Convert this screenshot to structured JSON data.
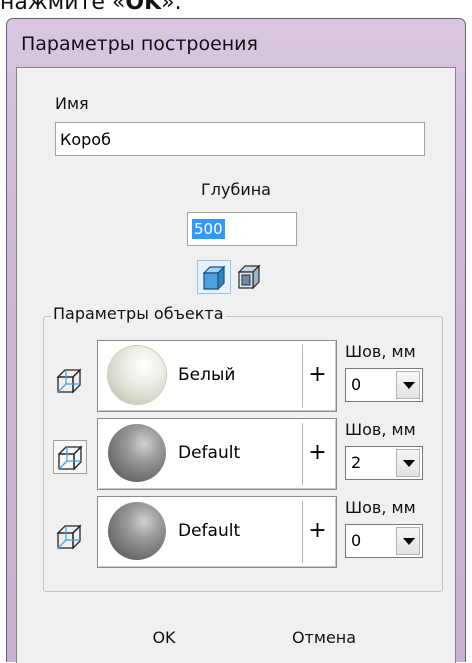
{
  "page_caption": {
    "prefix": "нажмите «",
    "bold": "OK",
    "suffix": "»."
  },
  "window": {
    "title": "Параметры построения"
  },
  "name_field": {
    "label": "Имя",
    "value": "Короб"
  },
  "depth_field": {
    "label": "Глубина",
    "value": "500"
  },
  "group": {
    "title": "Параметры объекта",
    "rows": [
      {
        "material": "Белый",
        "plus": "+",
        "seam_label": "Шов, мм",
        "seam_value": "0"
      },
      {
        "material": "Default",
        "plus": "+",
        "seam_label": "Шов, мм",
        "seam_value": "2"
      },
      {
        "material": "Default",
        "plus": "+",
        "seam_label": "Шов, мм",
        "seam_value": "0"
      }
    ]
  },
  "buttons": {
    "ok": "OK",
    "cancel": "Отмена"
  },
  "icons": {
    "box_outer": "box-icon",
    "box_inner": "box-inner-icon",
    "face": "cube-face-icon"
  },
  "colors": {
    "frame": "#cdb6d6",
    "client": "#f0f0f0",
    "selection": "#3399ff",
    "icon_blue": "#4aa3df"
  }
}
